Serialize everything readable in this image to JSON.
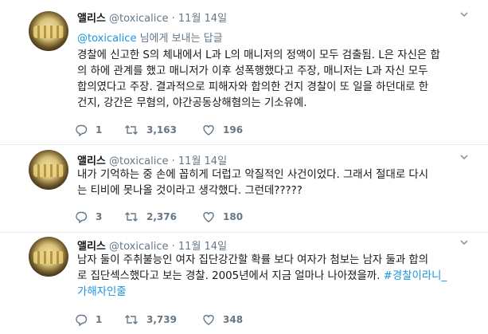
{
  "tweets": [
    {
      "name": "앨리스",
      "handle": "@toxicalice",
      "separator": "·",
      "date": "11월 14일",
      "reply_to": {
        "mention": "@toxicalice",
        "suffix": " 님에게 보내는 답글"
      },
      "lines": [
        "경찰에 신고한 S의 체내에서 L과 L의 매니저의 정액이 모두 검출됨. L은 자신은 합",
        "의 하에 관계를 했고 매니저가 이후 성폭행했다고 주장, 매니저는 L과 자신 모두",
        "합의였다고 주장. 결과적으로 피해자와 합의한 건지 경찰이 또 일을 하던대로 한",
        "건지, 강간은 무혐의, 야간공동상해혐의는 기소유예."
      ],
      "replies": "1",
      "retweets": "3,163",
      "likes": "196"
    },
    {
      "name": "앨리스",
      "handle": "@toxicalice",
      "separator": "·",
      "date": "11월 14일",
      "lines": [
        "내가 기억하는 중 손에 꼽히게 더럽고 악질적인 사건이었다. 그래서 절대로 다시",
        "는 티비에 못나올 것이라고 생각했다. 그런데?????"
      ],
      "replies": "3",
      "retweets": "2,376",
      "likes": "180"
    },
    {
      "name": "앨리스",
      "handle": "@toxicalice",
      "separator": "·",
      "date": "11월 14일",
      "lines": [
        "남자 둘이 주취불능인 여자 집단강간할 확률 보다 여자가 첨보는 남자 둘과 합의",
        "로 집단섹스했다고 보는 경찰. 2005년에서 지금 얼마나 나아졌을까. "
      ],
      "hashtag_tail": "#경찰이라니_",
      "hashtag_line": "가해자인줄",
      "replies": "1",
      "retweets": "3,739",
      "likes": "348"
    }
  ],
  "icons": {
    "reply": "reply-icon",
    "retweet": "retweet-icon",
    "like": "heart-icon",
    "caret": "chevron-down-icon"
  },
  "colors": {
    "link": "#1b95e0",
    "meta": "#657786",
    "text": "#14171a",
    "divider": "#e6ecf0"
  }
}
